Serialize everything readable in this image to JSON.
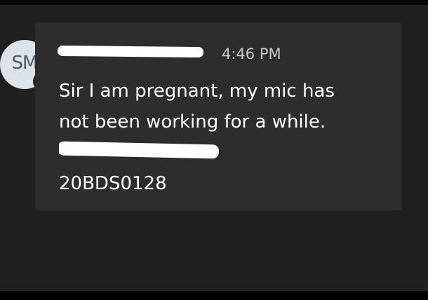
{
  "avatar": {
    "initials": "SM",
    "presence_status": "away",
    "presence_color": "#f2b01e"
  },
  "message": {
    "sender": "",
    "time": "4:46 PM",
    "lines": [
      "Sir I am pregnant, my mic has",
      "not been working for a while.",
      "",
      "20BDS0128"
    ]
  },
  "theme": {
    "background": "#1f1f1f",
    "bubble": "#2d2d2d",
    "text": "#ffffff",
    "meta_text": "#c8c8c8"
  }
}
